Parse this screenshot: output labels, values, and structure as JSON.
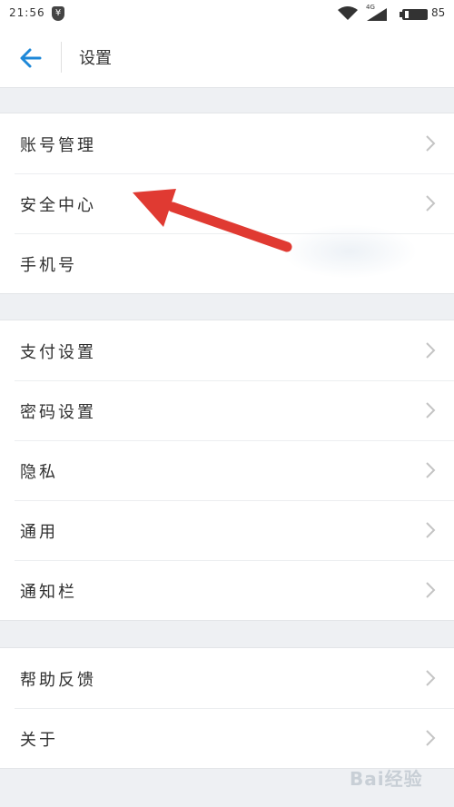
{
  "status_bar": {
    "time": "21:56",
    "yen_icon": "¥",
    "network": "4G",
    "battery": "85"
  },
  "header": {
    "title": "设置",
    "back_icon": "arrow-left-icon"
  },
  "groups": [
    {
      "items": [
        {
          "label": "账号管理"
        },
        {
          "label": "安全中心"
        },
        {
          "label": "手机号"
        }
      ]
    },
    {
      "items": [
        {
          "label": "支付设置"
        },
        {
          "label": "密码设置"
        },
        {
          "label": "隐私"
        },
        {
          "label": "通用"
        },
        {
          "label": "通知栏"
        }
      ]
    },
    {
      "items": [
        {
          "label": "帮助反馈"
        },
        {
          "label": "关于"
        }
      ]
    }
  ],
  "annotation": {
    "arrow_color": "#e03a32",
    "points_to": "安全中心"
  },
  "watermark": {
    "text": "Bai经验"
  },
  "colors": {
    "accent": "#1e88d8",
    "background": "#eef0f3",
    "chevron": "#c4c4c4"
  }
}
